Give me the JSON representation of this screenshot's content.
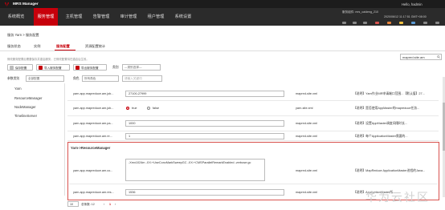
{
  "app": {
    "title": "MRS Manager",
    "hello": "Hello, hadmin"
  },
  "menu": [
    "系统概览",
    "服务管理",
    "主机管理",
    "告警管理",
    "审计管理",
    "租户管理",
    "系统设置"
  ],
  "menu_active_index": 1,
  "cluster_info": {
    "line1": "服务组件: mrs_caideng_210",
    "line2": "2020/06/12 11:17:51 GMT+08:00"
  },
  "breadcrumb": "服务 Yarn > 服务配置",
  "tabs": [
    "服务状态",
    "实例",
    "服务配置",
    "资源配置统计"
  ],
  "tab_active_index": 2,
  "note": "修改服务配置后需要保存并重启服务，已修改配置将在重启后生效。",
  "toolbar": {
    "save_label": "保存配置",
    "import_label": "导入服务配置",
    "export_label": "导出服务配置",
    "category_label": "类别",
    "category_value": "—类别选择—",
    "role_label": "角色",
    "role_value": "所有角色",
    "param_label": "参数类别",
    "param_value": "全部配置",
    "search_value": "mapred.site.am",
    "filter_placeholder": "请输入关键词"
  },
  "sidebar": [
    "Yarn",
    "ResourceManager",
    "NodeManager",
    "TimelineServer"
  ],
  "rows": [
    {
      "name": "yarn.app.mapreduce.am.job...",
      "value": "27100-27999",
      "file": "mapred-site.xml",
      "desc": "【说明】Yarn作业MR申请端口范围...【默认值】27..."
    },
    {
      "name": "yarn.app.mapreduce.am.job...",
      "radio_true": "true",
      "radio_false": "false",
      "file": "yarn-site.xml",
      "desc": "【说明】是否使用AppMaster的mapreduce任务..."
    },
    {
      "name": "yarn.app.mapreduce.am.pa...",
      "value": "1000",
      "file": "mapred-site.xml",
      "desc": "【说明】设置AppMaster调度间隔时长..."
    },
    {
      "name": "yarn.app.mapreduce.am.re...",
      "value": "1",
      "file": "mapred-site.xml",
      "desc": "【说明】每个ApplicationMaster需要的..."
    }
  ],
  "group": {
    "title": "Yarn->ResourceManager",
    "row1": {
      "name": "yarn.app.mapreduce.am.co...",
      "value": "-Xmx1024m -XX:+UseConcMarkSweepGC -XX:+CMSParallelRemarkEnabled -verbose:gc",
      "file": "mapred-site.xml",
      "desc": "【说明】MapReduce ApplicationMaster进程的Java..."
    },
    "row2": {
      "name": "yarn.app.mapreduce.am.res...",
      "value": "1536",
      "file": "mapred-site.xml",
      "desc": "【说明】ApplicationMaster所..."
    }
  },
  "footer": {
    "page_size": "10",
    "total": "总条数: 12",
    "page_prev": "‹",
    "page_current": "1",
    "page_next": "›"
  },
  "watermark": "华为云社区",
  "colors": {
    "accent": "#c7000b",
    "topbar": "#1c1c1c",
    "menubar": "#2b2b2b",
    "highlight_border": "#d9534f"
  }
}
